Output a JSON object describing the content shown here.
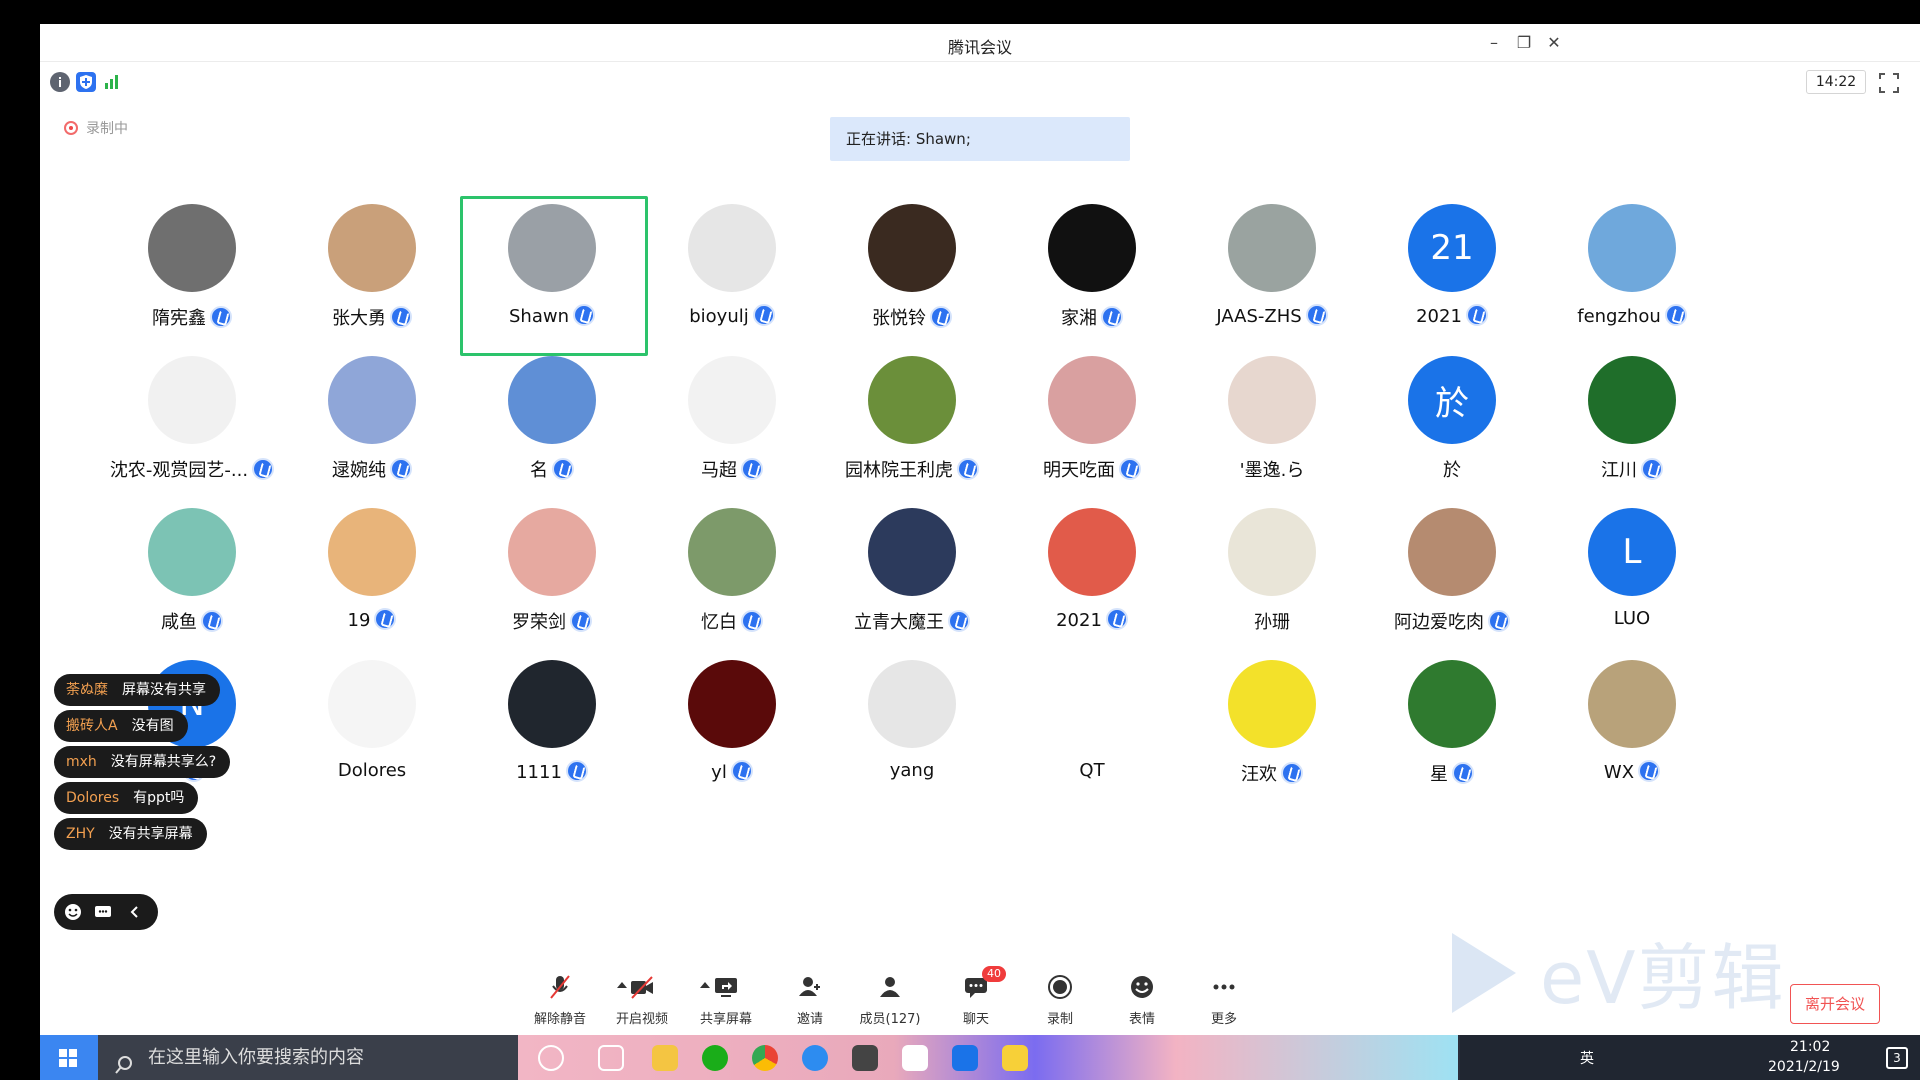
{
  "app": {
    "title": "腾讯会议"
  },
  "window_controls": [
    "minimize",
    "restore",
    "close"
  ],
  "status": {
    "icons": [
      "info-icon",
      "shield-icon",
      "signal-icon"
    ],
    "time": "14:22",
    "recording": "录制中"
  },
  "speaking": {
    "text": "正在讲话: Shawn;"
  },
  "participants": [
    {
      "name": "隋宪鑫",
      "mic": true,
      "color": "#6f6f6f"
    },
    {
      "name": "张大勇",
      "mic": true,
      "color": "#c9a07a"
    },
    {
      "name": "Shawn",
      "mic": true,
      "color": "#9aa0a6",
      "active": true
    },
    {
      "name": "bioyulj",
      "mic": true,
      "color": "#e6e6e6"
    },
    {
      "name": "张悦铃",
      "mic": true,
      "color": "#3a2a20"
    },
    {
      "name": "家湘",
      "mic": true,
      "color": "#111111"
    },
    {
      "name": "JAAS-ZHS",
      "mic": true,
      "color": "#9aa3a0"
    },
    {
      "name": "2021",
      "mic": true,
      "color": "#1a73e8",
      "initial": "21"
    },
    {
      "name": "fengzhou",
      "mic": true,
      "color": "#6fa8dc"
    },
    {
      "name": "沈农-观赏园艺-...",
      "mic": true,
      "color": "#f1f1f1"
    },
    {
      "name": "逯婉纯",
      "mic": true,
      "color": "#8fa6d8"
    },
    {
      "name": "名",
      "mic": true,
      "color": "#5f8fd6"
    },
    {
      "name": "马超",
      "mic": true,
      "color": "#f2f2f2"
    },
    {
      "name": "园林院王利虎",
      "mic": true,
      "color": "#6b8f3a"
    },
    {
      "name": "明天吃面",
      "mic": true,
      "color": "#d9a0a0"
    },
    {
      "name": "'墨逸.ら",
      "mic": false,
      "color": "#e7d7cf"
    },
    {
      "name": "於",
      "mic": false,
      "color": "#1a73e8",
      "initial": "於"
    },
    {
      "name": "江川",
      "mic": true,
      "color": "#1f6e2a"
    },
    {
      "name": "咸鱼",
      "mic": true,
      "color": "#7cc3b4"
    },
    {
      "name": "19",
      "mic": true,
      "color": "#e8b47a"
    },
    {
      "name": "罗荣剑",
      "mic": true,
      "color": "#e6a9a0"
    },
    {
      "name": "忆白",
      "mic": true,
      "color": "#7d9a6a"
    },
    {
      "name": "立青大魔王",
      "mic": true,
      "color": "#2c3a5c"
    },
    {
      "name": "2021",
      "mic": true,
      "color": "#e15b4a"
    },
    {
      "name": "孙珊",
      "mic": false,
      "color": "#e9e5d8"
    },
    {
      "name": "阿边爱吃肉",
      "mic": true,
      "color": "#b58b70"
    },
    {
      "name": "LUO",
      "mic": false,
      "color": "#1a73e8",
      "initial": "L"
    },
    {
      "name": "",
      "mic": true,
      "color": "#1a73e8",
      "initial": "N"
    },
    {
      "name": "Dolores",
      "mic": false,
      "color": "#f5f5f5"
    },
    {
      "name": "1111",
      "mic": true,
      "color": "#20262e"
    },
    {
      "name": "yl",
      "mic": true,
      "color": "#5a0a0a"
    },
    {
      "name": "yang",
      "mic": false,
      "color": "#e6e6e6"
    },
    {
      "name": "QT",
      "mic": false,
      "color": "#ffffff"
    },
    {
      "name": "汪欢",
      "mic": true,
      "color": "#f3e12a"
    },
    {
      "name": "星",
      "mic": true,
      "color": "#2f7a2f"
    },
    {
      "name": "WX",
      "mic": true,
      "color": "#b8a27a"
    }
  ],
  "chat_messages": [
    {
      "user": "荼ぬ糜",
      "text": "屏幕没有共享"
    },
    {
      "user": "搬砖人A",
      "text": "没有图"
    },
    {
      "user": "mxh",
      "text": "没有屏幕共享么?"
    },
    {
      "user": "Dolores",
      "text": "有ppt吗"
    },
    {
      "user": "ZHY",
      "text": "没有共享屏幕"
    }
  ],
  "toolbar": [
    {
      "label": "解除静音",
      "icon": "mic-muted-icon"
    },
    {
      "label": "开启视频",
      "icon": "video-off-icon"
    },
    {
      "label": "共享屏幕",
      "icon": "share-screen-icon"
    },
    {
      "label": "邀请",
      "icon": "invite-icon"
    },
    {
      "label": "成员(127)",
      "icon": "members-icon"
    },
    {
      "label": "聊天",
      "icon": "chat-icon",
      "badge": "40"
    },
    {
      "label": "录制",
      "icon": "record-icon"
    },
    {
      "label": "表情",
      "icon": "emoji-icon"
    },
    {
      "label": "更多",
      "icon": "more-icon"
    }
  ],
  "leave_button": "离开会议",
  "watermark": "eV剪辑",
  "taskbar": {
    "search_placeholder": "在这里输入你要搜索的内容",
    "time": "21:02",
    "date": "2021/2/19",
    "ime": "英",
    "notifications": "3"
  }
}
